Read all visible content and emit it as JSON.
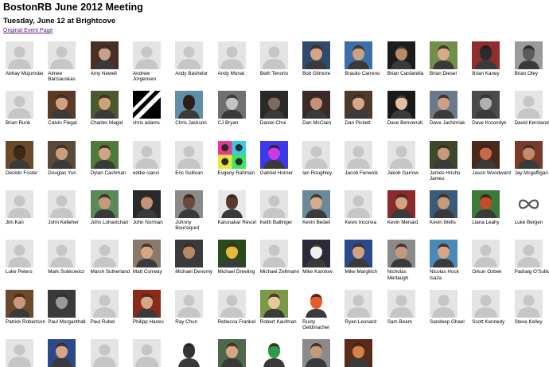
{
  "header": {
    "title": "BostonRB June 2012 Meeting",
    "subtitle": "Tuesday, June 12 at Brightcove",
    "event_link": "Original Event Page"
  },
  "colors": {
    "link_visited": "#551a8b",
    "placeholder_bg": "#e4e4e4",
    "placeholder_silhouette": "#c6c6c6"
  },
  "members": [
    {
      "name": "Abhay Mujumdar",
      "photo": false
    },
    {
      "name": "Aimee Barciauskas",
      "photo": false
    },
    {
      "name": "Amy Newell",
      "photo": true,
      "icon": "woman-dark-hair-photo",
      "c1": "#4b2f23",
      "c2": "#c9a08c"
    },
    {
      "name": "Andrew Jorgensen",
      "photo": false
    },
    {
      "name": "Andy Bashelor",
      "photo": false
    },
    {
      "name": "Andy Monat",
      "photo": false
    },
    {
      "name": "Beth Tenorio",
      "photo": false
    },
    {
      "name": "Bob Gilmore",
      "photo": true,
      "icon": "man-outdoor-photo",
      "c1": "#2f4a6b",
      "c2": "#d7a585"
    },
    {
      "name": "Braulio Carreno",
      "photo": true,
      "icon": "man-sunglasses-photo",
      "c1": "#3c6fa8",
      "c2": "#caa184"
    },
    {
      "name": "Brian Cardarella",
      "photo": true,
      "icon": "man-dark-photo",
      "c1": "#1c1c1c",
      "c2": "#b88a6c"
    },
    {
      "name": "Brian Diesel",
      "photo": true,
      "icon": "man-field-photo",
      "c1": "#6f8f4a",
      "c2": "#d6a98b"
    },
    {
      "name": "Brian Kaney",
      "photo": true,
      "icon": "man-red-background-photo",
      "c1": "#8f2c2c",
      "c2": "#2b2b2b"
    },
    {
      "name": "Brian Oley",
      "photo": true,
      "icon": "man-gray-photo",
      "c1": "#9a9a9a",
      "c2": "#5a5a5a"
    },
    {
      "name": "Brian Runk",
      "photo": false
    },
    {
      "name": "Calvin Flegal",
      "photo": true,
      "icon": "man-brown-photo",
      "c1": "#5b3a26",
      "c2": "#d2a182"
    },
    {
      "name": "Charles Magid",
      "photo": true,
      "icon": "man-outdoor-photo",
      "c1": "#4a5a2f",
      "c2": "#cfa07c"
    },
    {
      "name": "chris adams",
      "photo": true,
      "icon": "diagonal-stripes-logo",
      "c1": "#000000",
      "c2": "#ffffff"
    },
    {
      "name": "Chris Jackson",
      "photo": true,
      "icon": "bearded-cartoon-avatar",
      "c1": "#5f8fa8",
      "c2": "#2d1f18"
    },
    {
      "name": "CJ Bryan",
      "photo": true,
      "icon": "man-gray-photo",
      "c1": "#707070",
      "c2": "#c4c4c4"
    },
    {
      "name": "Daniel Choi",
      "photo": true,
      "icon": "man-dark-photo",
      "c1": "#2a2a2a",
      "c2": "#7a6a60"
    },
    {
      "name": "Dan McClain",
      "photo": true,
      "icon": "man-dark-photo",
      "c1": "#3a2a2a",
      "c2": "#c49276"
    },
    {
      "name": "Dan Pickett",
      "photo": true,
      "icon": "man-brown-photo",
      "c1": "#4c3a2c",
      "c2": "#d6a88a"
    },
    {
      "name": "Dave Benvenuti",
      "photo": true,
      "icon": "man-dark-suit-photo",
      "c1": "#1a1a1a",
      "c2": "#e0c0a8"
    },
    {
      "name": "Dave Jachimiak",
      "photo": true,
      "icon": "man-outdoor-photo",
      "c1": "#6a7a8a",
      "c2": "#cfa087"
    },
    {
      "name": "Dave Kroondyk",
      "photo": true,
      "icon": "man-gray-photo",
      "c1": "#4a4a4a",
      "c2": "#b0b0b0"
    },
    {
      "name": "David Kerstanski",
      "photo": false
    },
    {
      "name": "Decklin Foster",
      "photo": true,
      "icon": "man-brown-photo",
      "c1": "#6b4a2a",
      "c2": "#3a2a1a"
    },
    {
      "name": "Douglas Yun",
      "photo": true,
      "icon": "man-guitar-photo",
      "c1": "#5a4a3a",
      "c2": "#caa07c"
    },
    {
      "name": "Dylan Cashman",
      "photo": true,
      "icon": "man-outdoor-photo",
      "c1": "#4f7a3a",
      "c2": "#d2a486"
    },
    {
      "name": "eddie cianci",
      "photo": false
    },
    {
      "name": "Eric Sullivan",
      "photo": false
    },
    {
      "name": "Evgeny Rahman",
      "photo": true,
      "icon": "pop-art-grid-avatar",
      "c1": "#e83a8a",
      "c2": "#38c8e8"
    },
    {
      "name": "Gabriel Horner",
      "photo": true,
      "icon": "blue-purple-portrait",
      "c1": "#3a3ae8",
      "c2": "#c83ae8"
    },
    {
      "name": "Ian Roughley",
      "photo": false
    },
    {
      "name": "Jacob Fenwick",
      "photo": false
    },
    {
      "name": "Jakob Garrow",
      "photo": false
    },
    {
      "name": "James Hrisho James",
      "photo": true,
      "icon": "man-sunglasses-photo",
      "c1": "#3a4a2a",
      "c2": "#c49a7a"
    },
    {
      "name": "Jason Woodward",
      "photo": true,
      "icon": "man-red-face-photo",
      "c1": "#4a2a1a",
      "c2": "#c86a4a"
    },
    {
      "name": "Jay Mcgaffigan",
      "photo": true,
      "icon": "man-red-background-photo",
      "c1": "#7a3a2a",
      "c2": "#c48a6a"
    },
    {
      "name": "Jim Kan",
      "photo": false
    },
    {
      "name": "John Kelleher",
      "photo": false
    },
    {
      "name": "John Lohavichan",
      "photo": true,
      "icon": "man-outdoor-photo",
      "c1": "#5a8a5a",
      "c2": "#c49a7a"
    },
    {
      "name": "John Norman",
      "photo": true,
      "icon": "man-dark-photo",
      "c1": "#2a2a2a",
      "c2": "#c49476"
    },
    {
      "name": "Johnny Boursiquot",
      "photo": true,
      "icon": "man-gray-photo",
      "c1": "#8a8a8a",
      "c2": "#6a4a3a"
    },
    {
      "name": "Karunakar Revuri",
      "photo": true,
      "icon": "man-white-shirt-photo",
      "c1": "#e8e8e8",
      "c2": "#5a3a2a"
    },
    {
      "name": "Keith Ballinger",
      "photo": false
    },
    {
      "name": "Kevin Bedell",
      "photo": true,
      "icon": "man-outdoor-photo",
      "c1": "#6a8a9a",
      "c2": "#d6aa8c"
    },
    {
      "name": "Kevin Incorvia",
      "photo": false
    },
    {
      "name": "Kevin Menard",
      "photo": true,
      "icon": "man-red-background-photo",
      "c1": "#8a2a2a",
      "c2": "#d2a282"
    },
    {
      "name": "Kevin Wells",
      "photo": true,
      "icon": "couple-photo",
      "c1": "#3a5a7a",
      "c2": "#c49a7a"
    },
    {
      "name": "Liana Leahy",
      "photo": true,
      "icon": "woman-red-hair-photo",
      "c1": "#3a7a3a",
      "c2": "#c84a2a"
    },
    {
      "name": "Luke Bergen",
      "photo": true,
      "icon": "infinity-logo",
      "c1": "#ffffff",
      "c2": "#555555"
    },
    {
      "name": "Luke Peters",
      "photo": false
    },
    {
      "name": "Mark Sobkowicz",
      "photo": false
    },
    {
      "name": "Marsh Sutherland",
      "photo": false
    },
    {
      "name": "Matt Conway",
      "photo": true,
      "icon": "man-smiling-photo",
      "c1": "#8a7a6a",
      "c2": "#d6a688"
    },
    {
      "name": "Michael Denomy",
      "photo": true,
      "icon": "man-cap-photo",
      "c1": "#3a3a3a",
      "c2": "#b48a6a"
    },
    {
      "name": "Michael Dreeling",
      "photo": true,
      "icon": "meditating-figure-art",
      "c1": "#2a4a1a",
      "c2": "#e8b83a"
    },
    {
      "name": "Michael Zellmann",
      "photo": false
    },
    {
      "name": "Mike Karolow",
      "photo": true,
      "icon": "bird-photo",
      "c1": "#2a2a3a",
      "c2": "#f0f0f0"
    },
    {
      "name": "Mike Margitich",
      "photo": true,
      "icon": "man-blue-shirt-photo",
      "c1": "#2a4a8a",
      "c2": "#d2a282"
    },
    {
      "name": "Nicholas Mertaugh",
      "photo": true,
      "icon": "man-gray-photo",
      "c1": "#8a8a8a",
      "c2": "#c49a7a"
    },
    {
      "name": "Nicolas Hock Isaza",
      "photo": true,
      "icon": "man-glasses-photo",
      "c1": "#4a8ab8",
      "c2": "#d6a688"
    },
    {
      "name": "Orkun Ozbek",
      "photo": false
    },
    {
      "name": "Padraig O'Sullivan",
      "photo": false
    },
    {
      "name": "Patrick Robertson",
      "photo": true,
      "icon": "man-brown-photo",
      "c1": "#6a4a2a",
      "c2": "#c89878"
    },
    {
      "name": "Paul Morganthall",
      "photo": true,
      "icon": "cat-photo",
      "c1": "#3a3a3a",
      "c2": "#9a9a9a"
    },
    {
      "name": "Paul Rubel",
      "photo": false
    },
    {
      "name": "Philipp Hanes",
      "photo": true,
      "icon": "man-red-background-photo",
      "c1": "#8a2a1a",
      "c2": "#d6a686"
    },
    {
      "name": "Ray Chun",
      "photo": false
    },
    {
      "name": "Rebecca Frankel",
      "photo": false
    },
    {
      "name": "Robert Kaufman",
      "photo": true,
      "icon": "cartoon-cat-avatar",
      "c1": "#7a9a4a",
      "c2": "#e8c89a"
    },
    {
      "name": "Rusty Geldmacher",
      "photo": true,
      "icon": "cartoon-character-avatar",
      "c1": "#ffffff",
      "c2": "#e85a2a"
    },
    {
      "name": "Ryan Leonard",
      "photo": false
    },
    {
      "name": "Sam Beam",
      "photo": false
    },
    {
      "name": "Sandeep Ghael",
      "photo": false
    },
    {
      "name": "Scott Kennedy",
      "photo": false
    },
    {
      "name": "Steve Kelley",
      "photo": false
    },
    {
      "name": "",
      "photo": false
    },
    {
      "name": "",
      "photo": true,
      "icon": "man-blue-shirt-photo",
      "c1": "#2a4a8a",
      "c2": "#d6a686"
    },
    {
      "name": "",
      "photo": false
    },
    {
      "name": "",
      "photo": false
    },
    {
      "name": "",
      "photo": true,
      "icon": "sketch-figure-avatar",
      "c1": "#ffffff",
      "c2": "#333333"
    },
    {
      "name": "",
      "photo": true,
      "icon": "man-cap-photo",
      "c1": "#4a6a4a",
      "c2": "#d6a686"
    },
    {
      "name": "",
      "photo": true,
      "icon": "cartoon-robot-avatar",
      "c1": "#ffffff",
      "c2": "#2a9a4a"
    },
    {
      "name": "",
      "photo": true,
      "icon": "man-outdoor-photo",
      "c1": "#8a8a8a",
      "c2": "#c49a7a"
    },
    {
      "name": "",
      "photo": true,
      "icon": "man-red-face-photo",
      "c1": "#5a2a1a",
      "c2": "#d2824a"
    }
  ]
}
